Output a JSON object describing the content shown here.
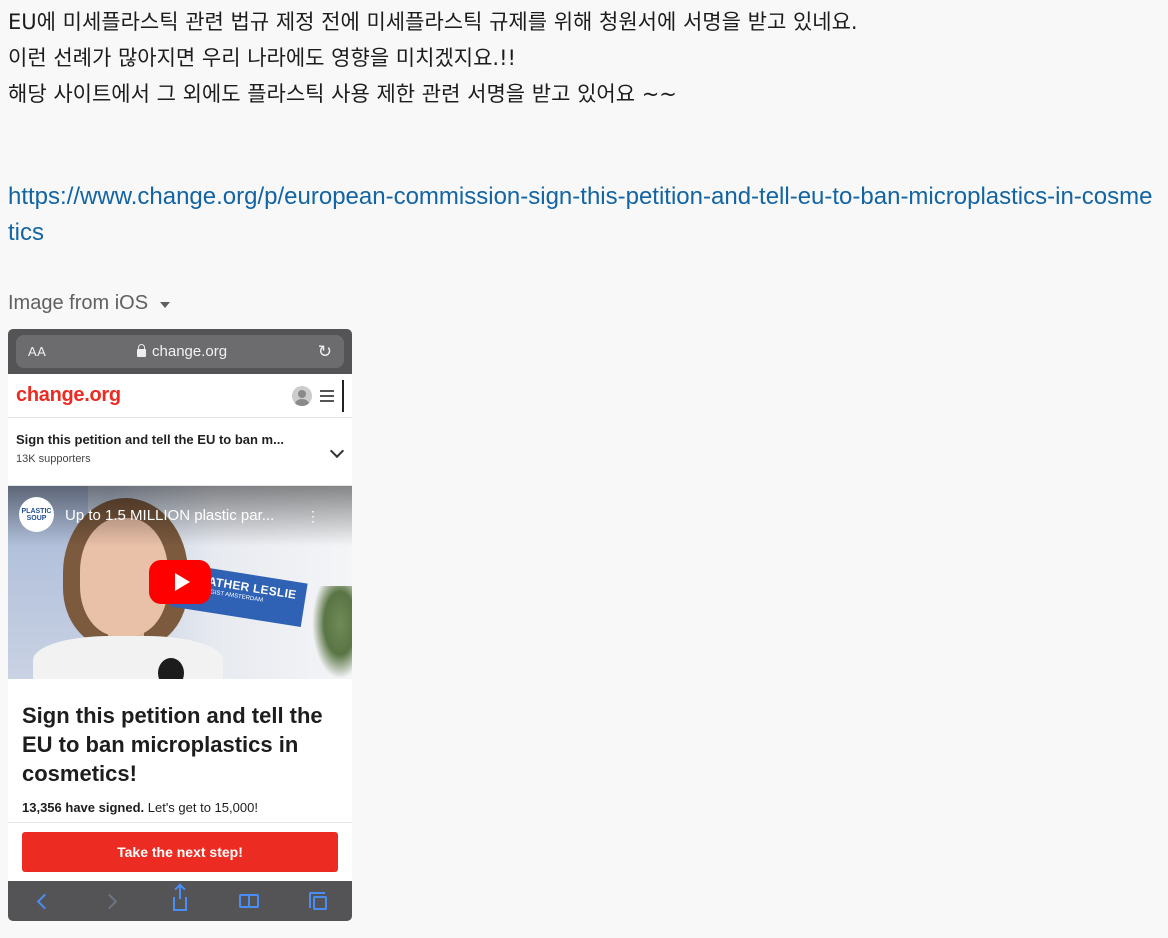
{
  "message": {
    "lines": [
      "EU에 미세플라스틱 관련 법규 제정 전에 미세플라스틱 규제를 위해 청원서에 서명을 받고 있네요.",
      "이런 선례가 많아지면 우리 나라에도 영향을 미치겠지요.!!",
      "해당 사이트에서 그 외에도 플라스틱 사용 제한 관련 서명을 받고 있어요 ~~"
    ],
    "link": "https://www.change.org/p/european-commission-sign-this-petition-and-tell-eu-to-ban-microplastics-in-cosmetics"
  },
  "attachment": {
    "label": "Image from iOS"
  },
  "screenshot": {
    "safari": {
      "aa_label": "AA",
      "url": "change.org",
      "reload_glyph": "↻"
    },
    "site": {
      "logo": "change.org"
    },
    "petition_bar": {
      "title": "Sign this petition and tell the EU to ban m...",
      "supporters": "13K supporters"
    },
    "video": {
      "channel_logo": "PLASTIC SOUP",
      "title": "Up to 1.5 MILLION plastic par...",
      "more_glyph": "⋮",
      "name_band": "HEATHER LESLIE",
      "name_band_sub": "ECOLOGIST AMSTERDAM"
    },
    "petition": {
      "title": "Sign this petition and tell the EU to ban microplastics in cosmetics!",
      "signed_count": "13,356 have signed.",
      "signed_goal": "Let's get to 15,000!",
      "cta": "Take the next step!"
    }
  },
  "colors": {
    "link": "#1264a3",
    "brand_red": "#ec2c22",
    "safari_tint": "#4a8ef5"
  }
}
